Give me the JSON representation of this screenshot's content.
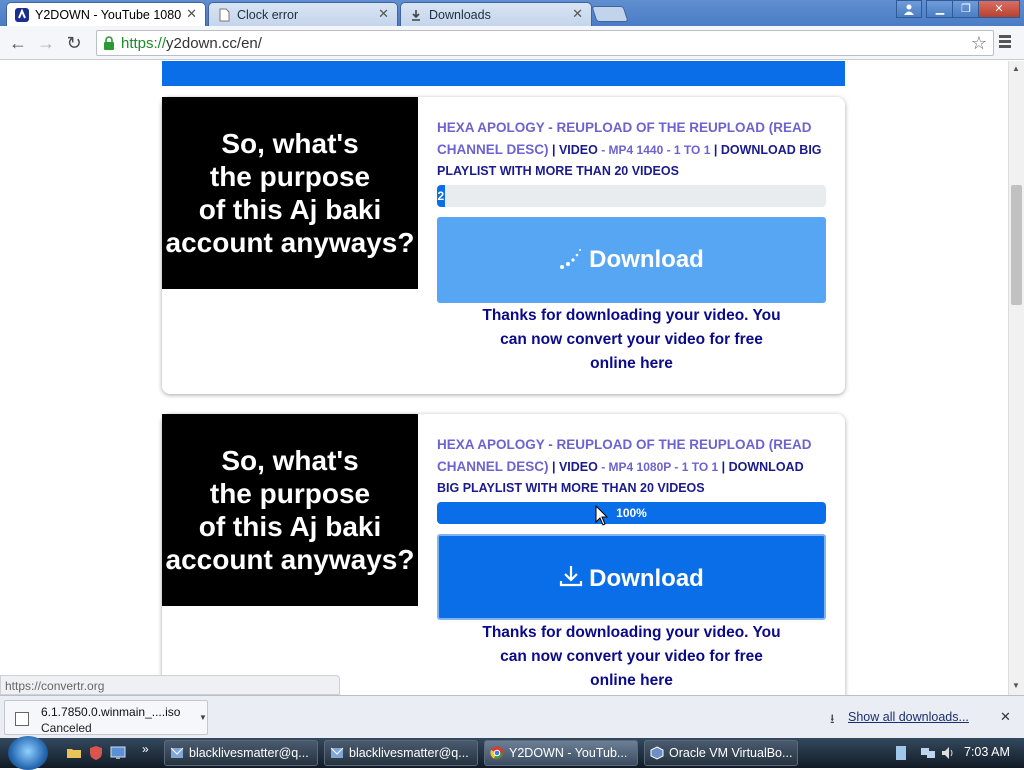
{
  "browser": {
    "tabs": [
      {
        "label": "Y2DOWN - YouTube 1080",
        "active": true
      },
      {
        "label": "Clock error",
        "active": false
      },
      {
        "label": "Downloads",
        "active": false
      }
    ],
    "url_scheme": "https://",
    "url_rest": "y2down.cc/en/"
  },
  "cards": [
    {
      "thumb_lines": [
        "So, what's",
        "the purpose",
        "of this Aj baki",
        "account anyways?"
      ],
      "title_a": "HEXA APOLOGY - REUPLOAD OF THE REUPLOAD (READ CHANNEL DESC)",
      "sep1": " | ",
      "video_label": "VIDEO",
      "format": " - MP4 1440 - 1 TO 1",
      "sep2": " | ",
      "playlist": "DOWNLOAD BIG PLAYLIST WITH MORE THAN 20 VIDEOS",
      "progress_text": "2",
      "progress_value": 0.02,
      "download_label": "Download",
      "thanks": [
        "Thanks for downloading your video. You",
        "can now convert your video for free",
        "online here"
      ]
    },
    {
      "thumb_lines": [
        "So, what's",
        "the purpose",
        "of this Aj baki",
        "account anyways?"
      ],
      "title_a": "HEXA APOLOGY - REUPLOAD OF THE REUPLOAD (READ CHANNEL DESC)",
      "sep1": " | ",
      "video_label": "VIDEO",
      "format": " - MP4 1080P - 1 TO 1",
      "sep2": " | ",
      "playlist": "DOWNLOAD BIG PLAYLIST WITH MORE THAN 20 VIDEOS",
      "progress_text": "100%",
      "progress_value": 1.0,
      "download_label": "Download",
      "thanks": [
        "Thanks for downloading your video. You",
        "can now convert your video for free",
        "online here"
      ]
    }
  ],
  "status_url": "https://convertr.org",
  "downloads_shelf": {
    "file_name": "6.1.7850.0.winmain_....iso",
    "file_status": "Canceled",
    "show_all": "Show all downloads..."
  },
  "taskbar": {
    "tasks": [
      {
        "label": "blacklivesmatter@q...",
        "active": false
      },
      {
        "label": "blacklivesmatter@q...",
        "active": false
      },
      {
        "label": "Y2DOWN - YouTub...",
        "active": true
      },
      {
        "label": "Oracle VM VirtualBo...",
        "active": false
      }
    ],
    "clock": "7:03 AM"
  },
  "colors": {
    "accent": "#0a6ee8",
    "loading_button": "#57a6f3",
    "title_purple": "#6c63cf",
    "thanks_navy": "#0a0a8a"
  }
}
